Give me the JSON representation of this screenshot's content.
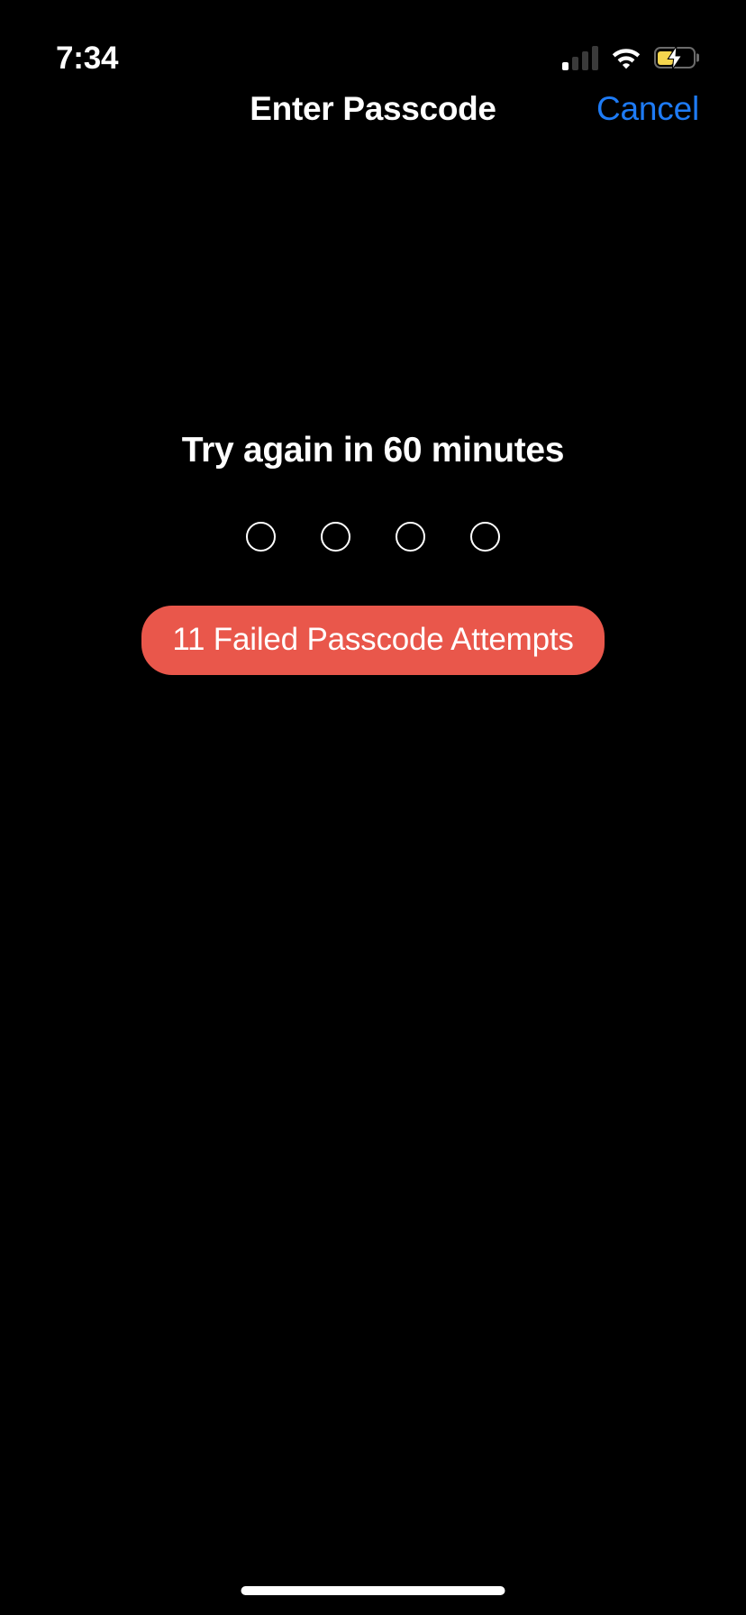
{
  "screen": {
    "name": "ios-lock-screen-passcode",
    "background_color": "#000000"
  },
  "status_bar": {
    "time": "7:34",
    "cellular": {
      "icon": "cellular-signal-icon",
      "bars_total": 4,
      "bars_active": 1
    },
    "wifi": {
      "icon": "wifi-icon",
      "strength": "full"
    },
    "battery": {
      "icon": "battery-charging-icon",
      "charging": true,
      "low_power_mode": true,
      "fill_color": "#F5D64E",
      "fill_percent": 42
    }
  },
  "nav_bar": {
    "title": "Enter Passcode",
    "cancel_label": "Cancel",
    "cancel_color": "#1E7BF5"
  },
  "passcode": {
    "lockout_message": "Try again in 60 minutes",
    "dots": [
      {
        "filled": false
      },
      {
        "filled": false
      },
      {
        "filled": false
      },
      {
        "filled": false
      }
    ],
    "attempts_badge": {
      "label": "11 Failed Passcode Attempts",
      "background_color": "#E9574B",
      "text_color": "#FFFFFF"
    }
  },
  "home_indicator": {
    "color": "#FFFFFF"
  }
}
